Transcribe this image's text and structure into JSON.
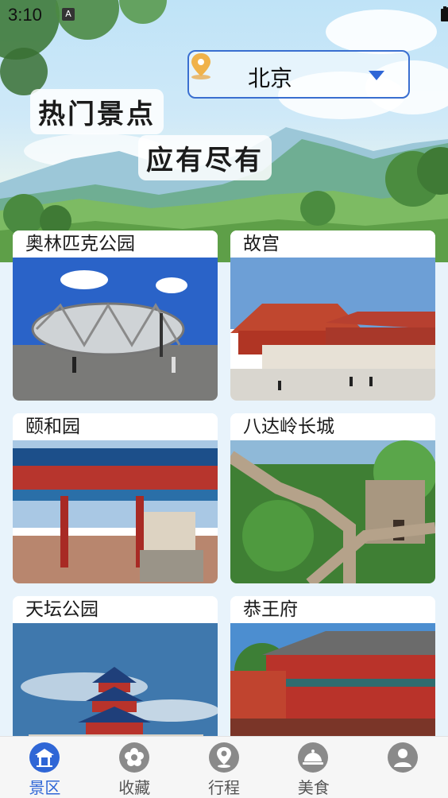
{
  "status_bar": {
    "time": "3:10",
    "notif_letter": "A"
  },
  "city_selector": {
    "value": "北京"
  },
  "slogan": {
    "line1": "热门景点",
    "line2": "应有尽有"
  },
  "attractions": [
    {
      "name": "奥林匹克公园"
    },
    {
      "name": "故宫"
    },
    {
      "name": "颐和园"
    },
    {
      "name": "八达岭长城"
    },
    {
      "name": "天坛公园"
    },
    {
      "name": "恭王府"
    }
  ],
  "tabs": [
    {
      "label": "景区",
      "icon": "scenic-gate-icon",
      "active": true
    },
    {
      "label": "收藏",
      "icon": "flower-icon",
      "active": false
    },
    {
      "label": "行程",
      "icon": "location-pin-icon",
      "active": false
    },
    {
      "label": "美食",
      "icon": "food-cloche-icon",
      "active": false
    },
    {
      "label": "",
      "icon": "user-profile-icon",
      "active": false
    }
  ],
  "colors": {
    "accent": "#2f66d6",
    "inactive_icon": "#8a8a8a"
  }
}
